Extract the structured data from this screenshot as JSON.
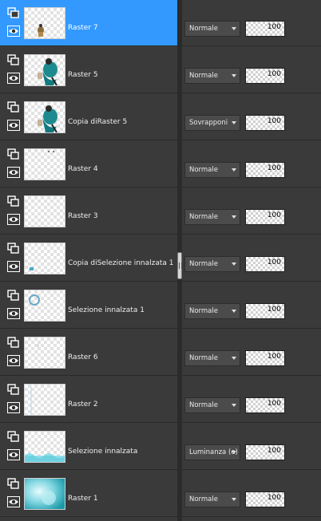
{
  "icons": {
    "group": "layer-group-icon",
    "visibility": "eye-icon",
    "dropdown": "chevron-down-icon"
  },
  "colors": {
    "selected_row": "#3399ff",
    "panel_bg": "#3a3a3a"
  },
  "layers": [
    {
      "name": "Raster 7",
      "blend_mode": "Normale",
      "opacity": "100",
      "selected": true,
      "thumb": "figure-small"
    },
    {
      "name": "Raster 5",
      "blend_mode": "Normale",
      "opacity": "100",
      "selected": false,
      "thumb": "figure"
    },
    {
      "name": "Copia diRaster 5",
      "blend_mode": "Sovrapponi",
      "opacity": "100",
      "selected": false,
      "thumb": "figure"
    },
    {
      "name": "Raster 4",
      "blend_mode": "Normale",
      "opacity": "100",
      "selected": false,
      "thumb": "dots"
    },
    {
      "name": "Raster 3",
      "blend_mode": "Normale",
      "opacity": "100",
      "selected": false,
      "thumb": "empty"
    },
    {
      "name": "Copia diSelezione innalzata 1",
      "blend_mode": "Normale",
      "opacity": "100",
      "selected": false,
      "thumb": "small-mark"
    },
    {
      "name": "Selezione innalzata 1",
      "blend_mode": "Normale",
      "opacity": "100",
      "selected": false,
      "thumb": "circle"
    },
    {
      "name": "Raster 6",
      "blend_mode": "Normale",
      "opacity": "100",
      "selected": false,
      "thumb": "faint"
    },
    {
      "name": "Raster 2",
      "blend_mode": "Normale",
      "opacity": "100",
      "selected": false,
      "thumb": "line"
    },
    {
      "name": "Selezione innalzata",
      "blend_mode": "Luminanza (e)",
      "opacity": "100",
      "selected": false,
      "thumb": "bottom-band"
    },
    {
      "name": "Raster 1",
      "blend_mode": "Normale",
      "opacity": "100",
      "selected": false,
      "thumb": "teal"
    }
  ]
}
